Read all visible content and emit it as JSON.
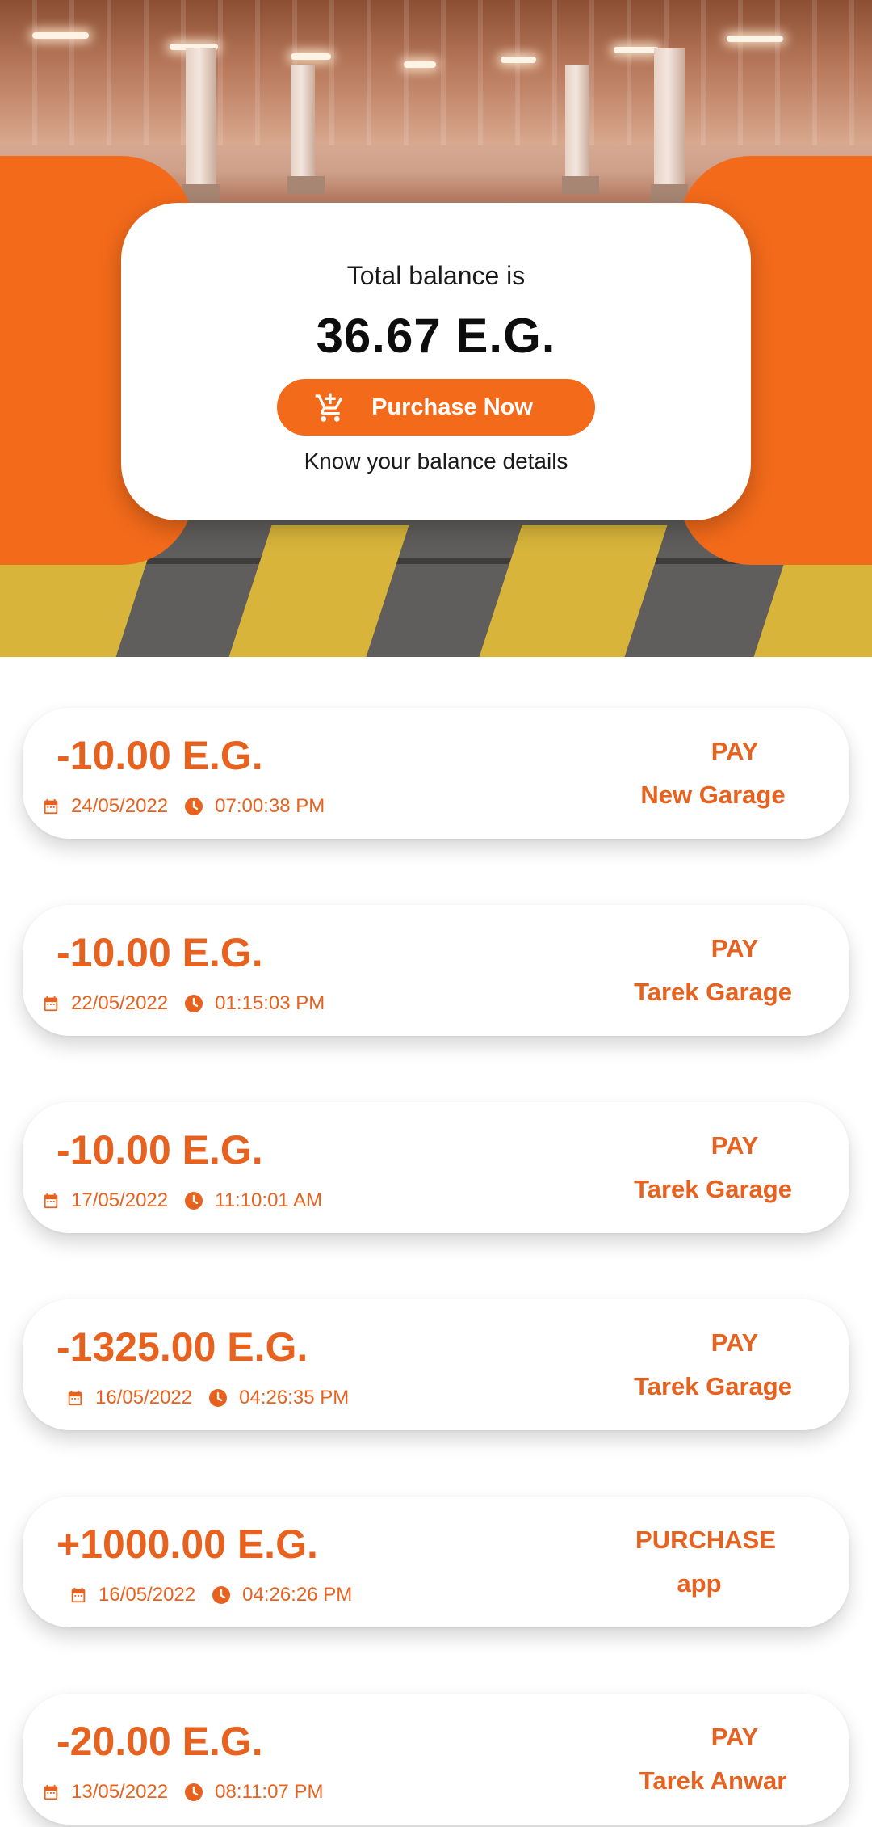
{
  "balance": {
    "label": "Total balance is",
    "amount": "36.67 E.G.",
    "purchase_button": "Purchase Now",
    "details_link": "Know your balance details"
  },
  "colors": {
    "accent": "#f36a1a",
    "text_accent": "#e8621f"
  },
  "transactions": [
    {
      "amount": "-10.00 E.G.",
      "date": "24/05/2022",
      "time": "07:00:38 PM",
      "type": "PAY",
      "target": "New Garage"
    },
    {
      "amount": "-10.00 E.G.",
      "date": "22/05/2022",
      "time": "01:15:03 PM",
      "type": "PAY",
      "target": "Tarek Garage"
    },
    {
      "amount": "-10.00 E.G.",
      "date": "17/05/2022",
      "time": "11:10:01 AM",
      "type": "PAY",
      "target": "Tarek Garage"
    },
    {
      "amount": "-1325.00 E.G.",
      "date": "16/05/2022",
      "time": "04:26:35 PM",
      "type": "PAY",
      "target": "Tarek Garage"
    },
    {
      "amount": "+1000.00 E.G.",
      "date": "16/05/2022",
      "time": "04:26:26 PM",
      "type": "PURCHASE",
      "target": "app"
    },
    {
      "amount": "-20.00 E.G.",
      "date": "13/05/2022",
      "time": "08:11:07 PM",
      "type": "PAY",
      "target": "Tarek Anwar"
    }
  ],
  "icons": [
    "cart-plus-icon",
    "calendar-icon",
    "clock-icon"
  ]
}
